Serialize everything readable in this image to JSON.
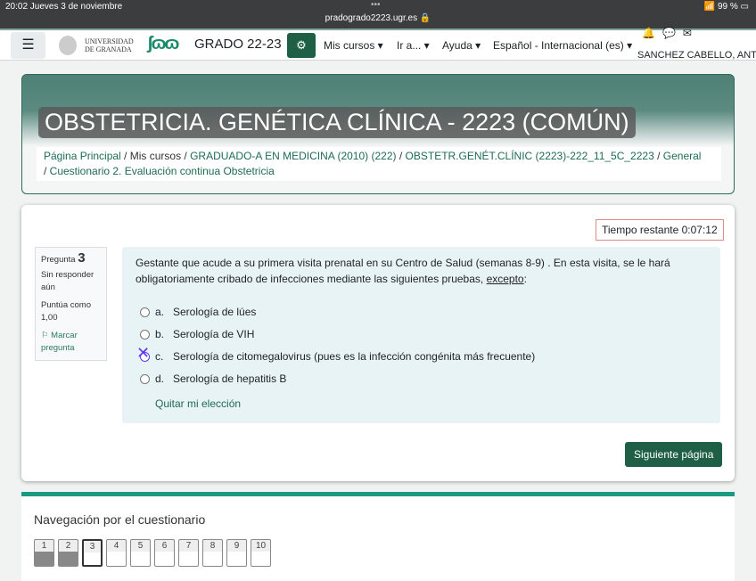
{
  "status": {
    "time": "20:02  Jueves 3 de noviembre",
    "url": "pradogrado2223.ugr.es 🔒",
    "battery": "99 %"
  },
  "nav": {
    "university": "UNIVERSIDAD",
    "university2": "DE GRANADA",
    "logo": "PRADO",
    "site": "GRADO 22-23",
    "menus": [
      "Mis cursos ▾",
      "Ir a... ▾",
      "Ayuda ▾",
      "Español - Internacional (es) ▾"
    ],
    "user": "SANCHEZ CABELLO, ANT"
  },
  "course": {
    "title": "OBSTETRICIA. GENÉTICA CLÍNICA - 2223 (COMÚN)",
    "breadcrumb": [
      "Página Principal",
      "Mis cursos",
      "GRADUADO-A EN MEDICINA (2010) (222)",
      "OBSTETR.GENÉT.CLÍNIC (2223)-222_11_5C_2223",
      "General",
      "Cuestionario 2. Evaluación continua Obstetricia"
    ]
  },
  "quiz": {
    "timer": "Tiempo restante 0:07:12",
    "info": {
      "label": "Pregunta",
      "number": "3",
      "state": "Sin responder aún",
      "grade": "Puntúa como 1,00",
      "flag": "Marcar pregunta"
    },
    "question": "Gestante que acude a su primera visita prenatal en su Centro de Salud (semanas 8-9) . En esta visita, se le hará obligatoriamente cribado de infecciones mediante las siguientes pruebas, ",
    "question_emph": "excepto",
    "question_end": ":",
    "options": [
      {
        "letter": "a.",
        "text": "Serología de lúes"
      },
      {
        "letter": "b.",
        "text": "Serología de VIH"
      },
      {
        "letter": "c.",
        "text": "Serología de citomegalovirus (pues es la infección congénita más frecuente)"
      },
      {
        "letter": "d.",
        "text": "Serología de hepatitis B"
      }
    ],
    "clear": "Quitar mi elección",
    "next": "Siguiente página"
  },
  "navigation": {
    "title": "Navegación por el cuestionario",
    "buttons": [
      "1",
      "2",
      "3",
      "4",
      "5",
      "6",
      "7",
      "8",
      "9",
      "10"
    ],
    "answered": [
      "1",
      "2"
    ],
    "current": "3"
  }
}
